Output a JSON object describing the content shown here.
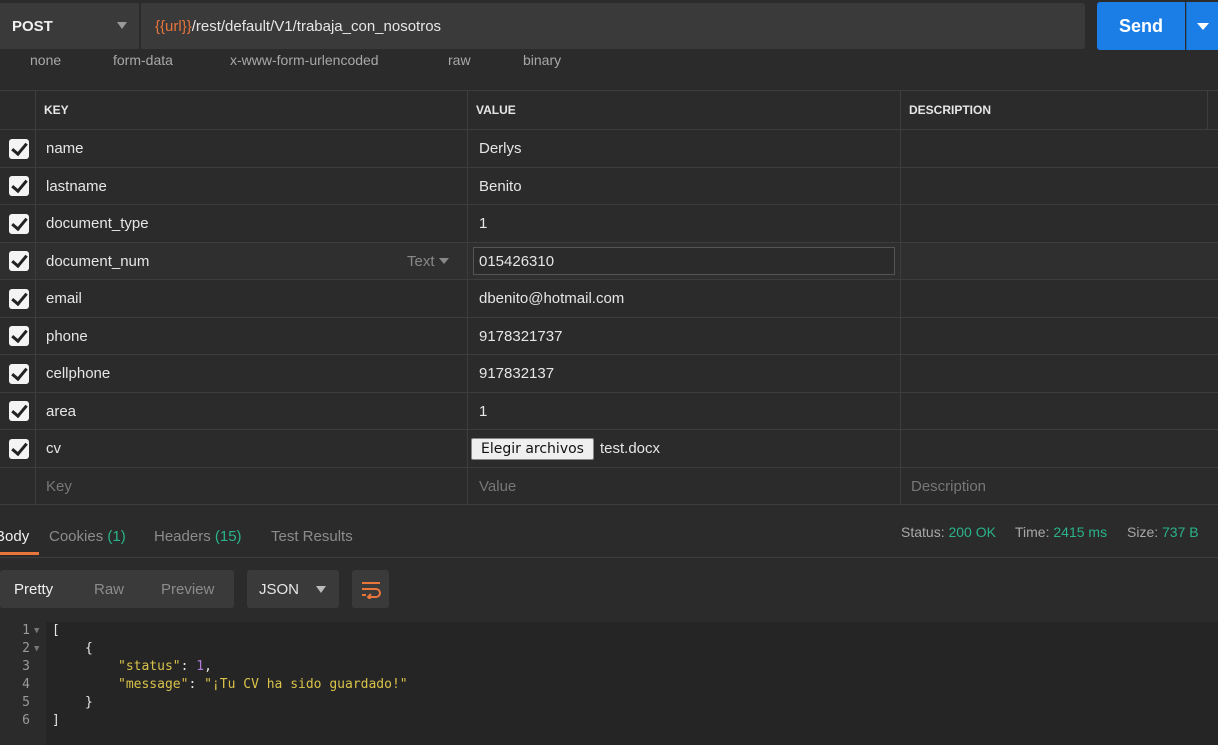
{
  "request": {
    "method": "POST",
    "url_var": "{{url}}",
    "url_path": "/rest/default/V1/trabaja_con_nosotros",
    "send_label": "Send"
  },
  "body_types": [
    "none",
    "form-data",
    "x-www-form-urlencoded",
    "raw",
    "binary"
  ],
  "params": {
    "headers": {
      "key": "KEY",
      "value": "VALUE",
      "description": "DESCRIPTION"
    },
    "rows": [
      {
        "key": "name",
        "value": "Derlys"
      },
      {
        "key": "lastname",
        "value": "Benito"
      },
      {
        "key": "document_type",
        "value": "1"
      },
      {
        "key": "document_num",
        "value": "015426310",
        "type": "Text"
      },
      {
        "key": "email",
        "value": "dbenito@hotmail.com"
      },
      {
        "key": "phone",
        "value": "9178321737"
      },
      {
        "key": "cellphone",
        "value": "917832137"
      },
      {
        "key": "area",
        "value": "1"
      },
      {
        "key": "cv",
        "file_button": "Elegir archivos",
        "file_name": "test.docx"
      }
    ],
    "placeholders": {
      "key": "Key",
      "value": "Value",
      "description": "Description"
    }
  },
  "response": {
    "tabs": {
      "body": "Body",
      "cookies": "Cookies",
      "cookies_count": "(1)",
      "headers": "Headers",
      "headers_count": "(15)",
      "tests": "Test Results"
    },
    "status_label": "Status:",
    "status_value": "200 OK",
    "time_label": "Time:",
    "time_value": "2415 ms",
    "size_label": "Size:",
    "size_value": "737 B",
    "view_modes": [
      "Pretty",
      "Raw",
      "Preview"
    ],
    "format": "JSON",
    "code": {
      "line_numbers": [
        "1",
        "2",
        "3",
        "4",
        "5",
        "6"
      ],
      "open_bracket": "[",
      "open_brace": "{",
      "status_key": "\"status\"",
      "status_val": "1",
      "message_key": "\"message\"",
      "message_val": "\"¡Tu CV ha sido guardado!\"",
      "close_brace": "}",
      "close_bracket": "]"
    }
  },
  "colors": {
    "accent": "#e8753a",
    "send": "#1b7ee6",
    "status_green": "#2ab38a"
  }
}
